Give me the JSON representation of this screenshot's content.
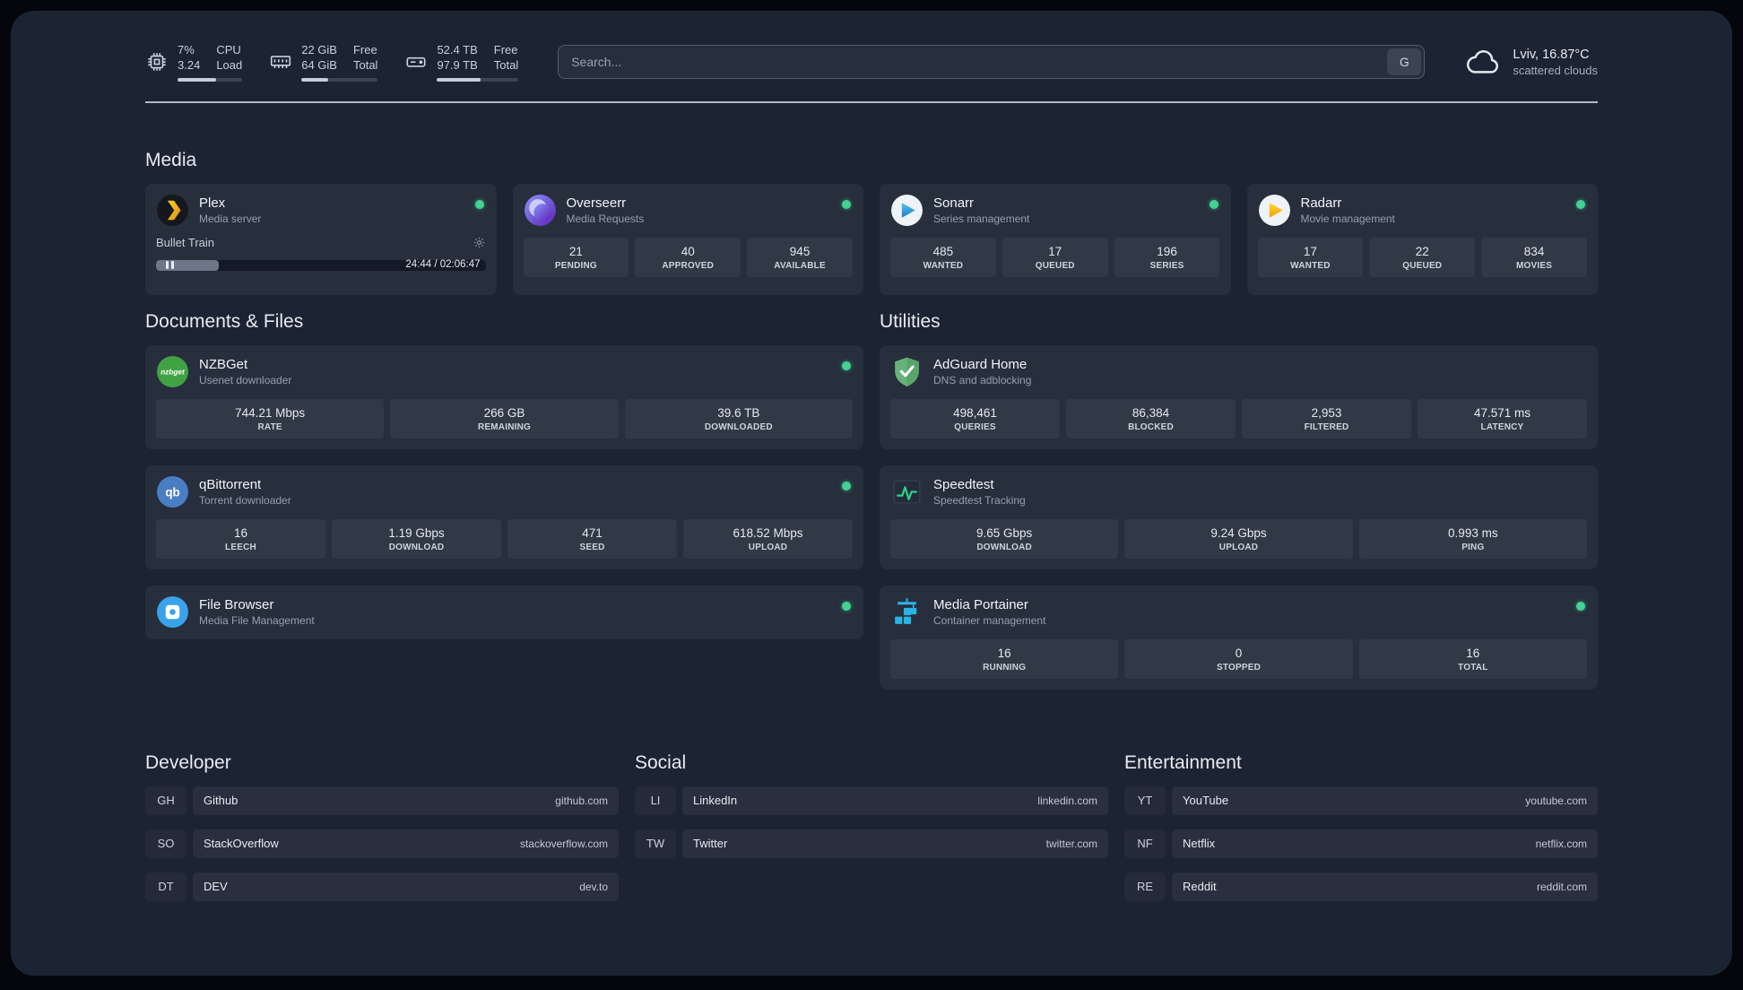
{
  "topbar": {
    "resources": [
      {
        "id": "cpu",
        "icon": "cpu-icon",
        "values": [
          "7%",
          "3.24"
        ],
        "labels": [
          "CPU",
          "Load"
        ],
        "progress": 60
      },
      {
        "id": "memory",
        "icon": "memory-icon",
        "values": [
          "22 GiB",
          "64 GiB"
        ],
        "labels": [
          "Free",
          "Total"
        ],
        "progress": 35
      },
      {
        "id": "disk",
        "icon": "disk-icon",
        "values": [
          "52.4 TB",
          "97.9 TB"
        ],
        "labels": [
          "Free",
          "Total"
        ],
        "progress": 54
      }
    ],
    "search": {
      "placeholder": "Search...",
      "provider_label": "G"
    },
    "weather": {
      "icon": "cloud-icon",
      "location": "Lviv, 16.87°C",
      "condition": "scattered clouds"
    }
  },
  "service_groups": [
    {
      "title": "Media",
      "services": [
        {
          "name": "Plex",
          "subtitle": "Media server",
          "icon": "plex-icon",
          "status": true,
          "player": {
            "track": "Bullet Train",
            "time": "24:44 / 02:06:47",
            "progress": 19
          }
        },
        {
          "name": "Overseerr",
          "subtitle": "Media Requests",
          "icon": "overseerr-icon",
          "status": true,
          "stats": [
            {
              "value": "21",
              "label": "PENDING"
            },
            {
              "value": "40",
              "label": "APPROVED"
            },
            {
              "value": "945",
              "label": "AVAILABLE"
            }
          ]
        },
        {
          "name": "Sonarr",
          "subtitle": "Series management",
          "icon": "sonarr-icon",
          "status": true,
          "stats": [
            {
              "value": "485",
              "label": "WANTED"
            },
            {
              "value": "17",
              "label": "QUEUED"
            },
            {
              "value": "196",
              "label": "SERIES"
            }
          ]
        },
        {
          "name": "Radarr",
          "subtitle": "Movie management",
          "icon": "radarr-icon",
          "status": true,
          "stats": [
            {
              "value": "17",
              "label": "WANTED"
            },
            {
              "value": "22",
              "label": "QUEUED"
            },
            {
              "value": "834",
              "label": "MOVIES"
            }
          ]
        }
      ]
    },
    {
      "title": "Documents & Files",
      "services": [
        {
          "name": "NZBGet",
          "subtitle": "Usenet downloader",
          "icon": "nzbget-icon",
          "status": true,
          "stats": [
            {
              "value": "744.21 Mbps",
              "label": "RATE"
            },
            {
              "value": "266 GB",
              "label": "REMAINING"
            },
            {
              "value": "39.6 TB",
              "label": "DOWNLOADED"
            }
          ]
        },
        {
          "name": "qBittorrent",
          "subtitle": "Torrent downloader",
          "icon": "qbittorrent-icon",
          "status": true,
          "stats": [
            {
              "value": "16",
              "label": "LEECH"
            },
            {
              "value": "1.19 Gbps",
              "label": "DOWNLOAD"
            },
            {
              "value": "471",
              "label": "SEED"
            },
            {
              "value": "618.52 Mbps",
              "label": "UPLOAD"
            }
          ]
        },
        {
          "name": "File Browser",
          "subtitle": "Media File Management",
          "icon": "filebrowser-icon",
          "status": true
        }
      ]
    },
    {
      "title": "Utilities",
      "services": [
        {
          "name": "AdGuard Home",
          "subtitle": "DNS and adblocking",
          "icon": "adguard-icon",
          "status": false,
          "stats": [
            {
              "value": "498,461",
              "label": "QUERIES"
            },
            {
              "value": "86,384",
              "label": "BLOCKED"
            },
            {
              "value": "2,953",
              "label": "FILTERED"
            },
            {
              "value": "47.571 ms",
              "label": "LATENCY"
            }
          ]
        },
        {
          "name": "Speedtest",
          "subtitle": "Speedtest Tracking",
          "icon": "speedtest-icon",
          "status": false,
          "stats": [
            {
              "value": "9.65 Gbps",
              "label": "DOWNLOAD"
            },
            {
              "value": "9.24 Gbps",
              "label": "UPLOAD"
            },
            {
              "value": "0.993 ms",
              "label": "PING"
            }
          ]
        },
        {
          "name": "Media Portainer",
          "subtitle": "Container management",
          "icon": "portainer-icon",
          "status": true,
          "stats": [
            {
              "value": "16",
              "label": "RUNNING"
            },
            {
              "value": "0",
              "label": "STOPPED"
            },
            {
              "value": "16",
              "label": "TOTAL"
            }
          ]
        }
      ]
    }
  ],
  "bookmark_groups": [
    {
      "title": "Developer",
      "items": [
        {
          "abbr": "GH",
          "name": "Github",
          "url": "github.com"
        },
        {
          "abbr": "SO",
          "name": "StackOverflow",
          "url": "stackoverflow.com"
        },
        {
          "abbr": "DT",
          "name": "DEV",
          "url": "dev.to"
        }
      ]
    },
    {
      "title": "Social",
      "items": [
        {
          "abbr": "LI",
          "name": "LinkedIn",
          "url": "linkedin.com"
        },
        {
          "abbr": "TW",
          "name": "Twitter",
          "url": "twitter.com"
        }
      ]
    },
    {
      "title": "Entertainment",
      "items": [
        {
          "abbr": "YT",
          "name": "YouTube",
          "url": "youtube.com"
        },
        {
          "abbr": "NF",
          "name": "Netflix",
          "url": "netflix.com"
        },
        {
          "abbr": "RE",
          "name": "Reddit",
          "url": "reddit.com"
        }
      ]
    }
  ],
  "colors": {
    "status_green": "#42d392",
    "background": "#1c2332"
  }
}
